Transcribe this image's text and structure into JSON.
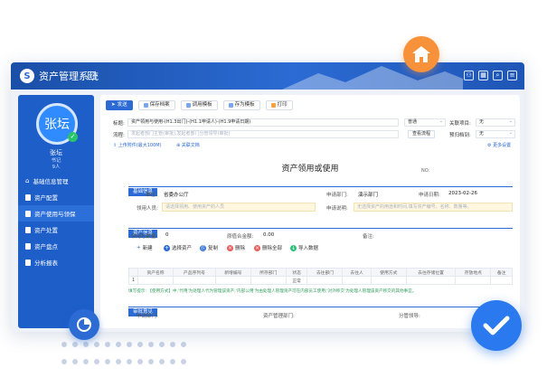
{
  "app": {
    "title": "资产管理系统"
  },
  "user": {
    "avatar_text": "张坛",
    "name": "张坛",
    "role": "书记",
    "count": "9人"
  },
  "sidebar": {
    "items": [
      {
        "label": "基础信息管理"
      },
      {
        "label": "资产配置"
      },
      {
        "label": "资产使用与领保"
      },
      {
        "label": "资产处置"
      },
      {
        "label": "资产盘点"
      },
      {
        "label": "分析报表"
      }
    ]
  },
  "toolbar": {
    "buttons": [
      "发送",
      "保存档案",
      "调用模板",
      "存为模板",
      "打印"
    ]
  },
  "form": {
    "subject_label": "标题:",
    "subject_value": "资产领用与使用-(H1.3出门)-(H1.1申请人)-(H1.9申请日期)",
    "priority": "普通",
    "related_label": "关联项目:",
    "related_value": "无",
    "flow_label": "流程:",
    "flow_placeholder": "发起者部门主管(审批),发起者部门分管领导(审批)",
    "view_flow": "查看流程",
    "archive_label": "预归档到:",
    "archive_value": "无",
    "attach": "上传附件(最大100M)",
    "related_doc": "关联文档",
    "more": "更多设置",
    "title": "资产领用或使用",
    "no_label": "NO:"
  },
  "basic": {
    "section": "基础信息",
    "unit_label": "单位:",
    "unit_value": "省委办公厅",
    "dept_label": "申请部门:",
    "dept_value": "演示部门",
    "date_label": "申请日期:",
    "date_value": "2023-02-26",
    "user_label": "领用人员:",
    "user_placeholder": "请选择领用、使用资产的人员",
    "desc_label": "申请说明:",
    "desc_placeholder": "无选择资产的用途和时间,填写资产编号、名称、数量等。"
  },
  "asset": {
    "section": "资产信息",
    "total_label": "领用总数量:",
    "total_value": "0",
    "amount_label": "原值合金额:",
    "amount_value": "0.00",
    "remark_label": "备注:",
    "buttons": [
      "新建",
      "选择资产",
      "复制",
      "删除",
      "删除全部",
      "导入数据"
    ],
    "columns": [
      "资产名称",
      "产品序列号",
      "新增编号",
      "所存部门",
      "状态",
      "去往部门",
      "去往人",
      "使用方式",
      "去往存储位置",
      "存放地点",
      "备注"
    ],
    "row": [
      "1",
      "",
      "",
      "",
      "",
      "",
      "正常",
      "",
      "",
      "",
      ""
    ],
    "hint": "填写提示: 【使用方式】中,'代用'为处理人代为管理该资产;'内部公用'为由处理人管理资产可在内部员工使用;'对外移交'为处理人管理该资产移交的其他事宜。"
  },
  "approval": {
    "section": "审批意见",
    "applicant_label": "申请部门:",
    "asset_dept_label": "资产管理部门:",
    "leader_label": "分管领导:"
  }
}
